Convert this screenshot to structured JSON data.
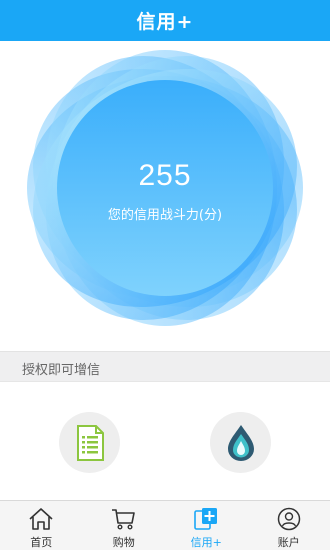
{
  "header": {
    "title": "信用+"
  },
  "score": {
    "value": "255",
    "label": "您的信用战斗力(分)"
  },
  "section": {
    "title": "授权即可增信"
  },
  "auth_items": [
    {
      "name": "document-list-icon"
    },
    {
      "name": "water-drop-icon"
    }
  ],
  "tabs": [
    {
      "label": "首页",
      "icon": "home-icon",
      "active": false
    },
    {
      "label": "购物",
      "icon": "cart-icon",
      "active": false
    },
    {
      "label": "信用+",
      "icon": "credit-plus-icon",
      "active": true
    },
    {
      "label": "账户",
      "icon": "user-icon",
      "active": false
    }
  ],
  "colors": {
    "brand": "#1aa7f6",
    "tab_active": "#1aa7f6",
    "document_green": "#8cc63f"
  }
}
